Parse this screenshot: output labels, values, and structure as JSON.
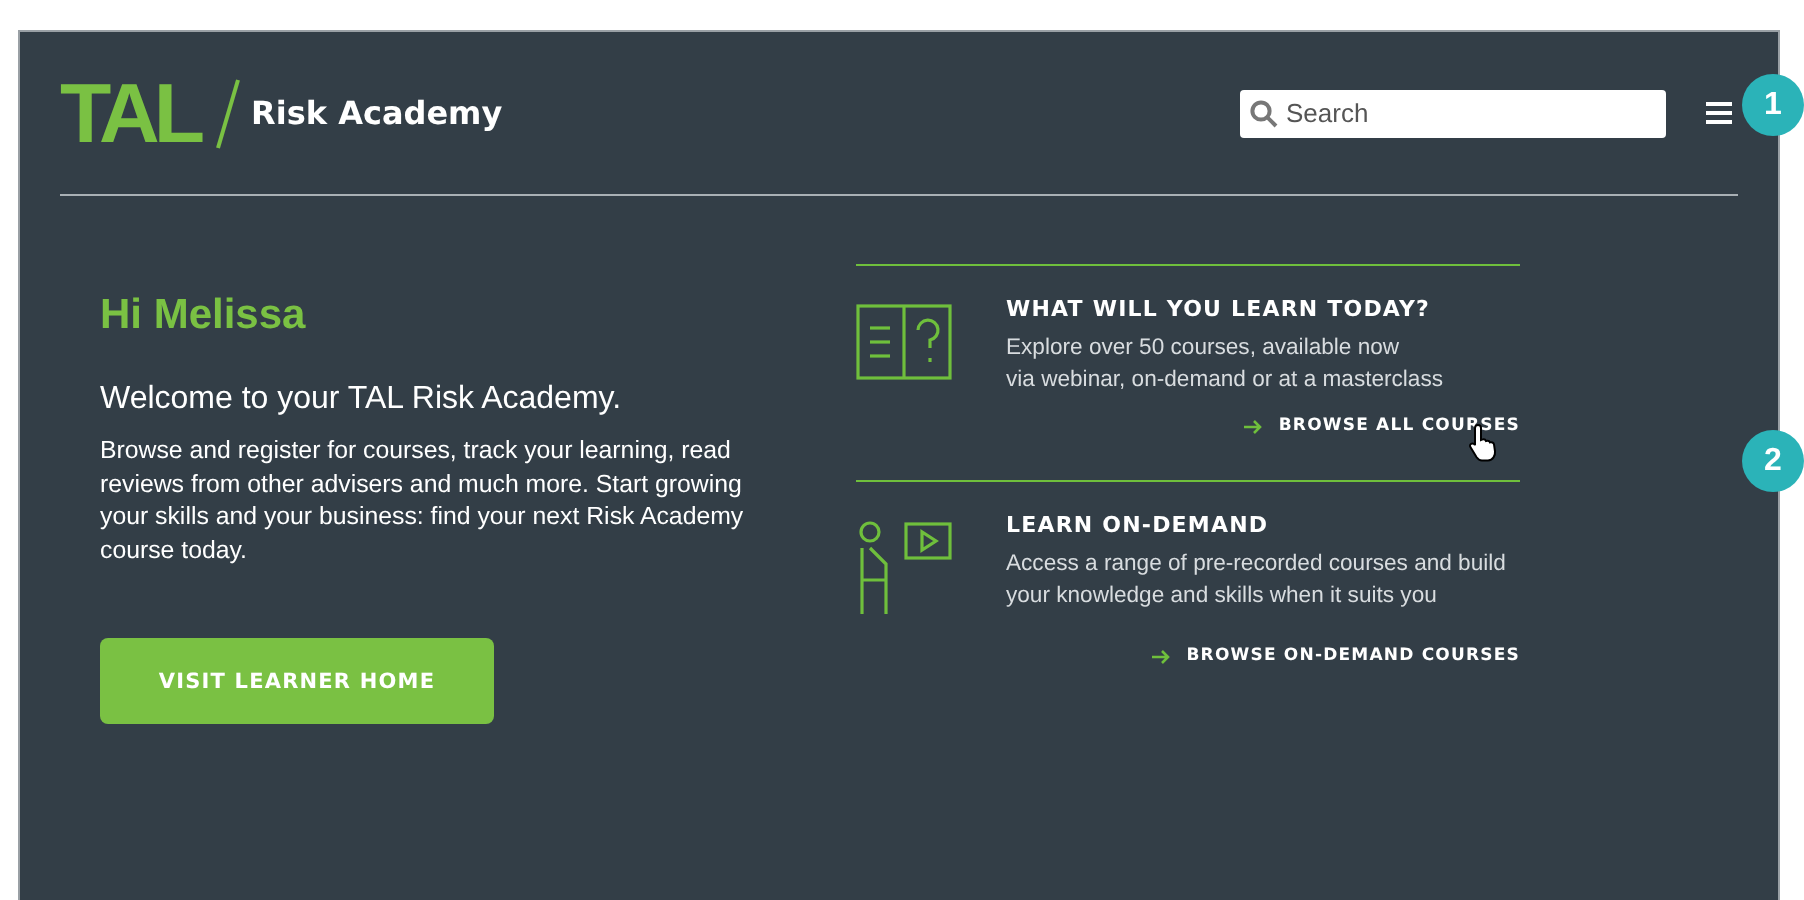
{
  "header": {
    "logo_mark": "TAL",
    "logo_name": "Risk Academy",
    "search": {
      "placeholder": "Search"
    }
  },
  "annotations": [
    {
      "label": "1"
    },
    {
      "label": "2"
    }
  ],
  "welcome": {
    "greeting": "Hi Melissa",
    "title": "Welcome to your TAL Risk Academy.",
    "body": "Browse and register for courses, track your learning, read reviews from other advisers and much more. Start growing your skills and your business: find your next Risk Academy course today.",
    "button": "VISIT LEARNER HOME"
  },
  "cards": [
    {
      "kind": "book",
      "heading": "WHAT WILL YOU LEARN TODAY?",
      "lines": [
        "Explore over 50 courses, available now",
        "via webinar, on-demand or at a masterclass"
      ],
      "link": "BROWSE ALL COURSES"
    },
    {
      "kind": "video",
      "heading": "LEARN ON-DEMAND",
      "lines": [
        "Access a range of pre-recorded courses and build",
        "your knowledge and skills when it suits you"
      ],
      "link": "BROWSE ON-DEMAND COURSES"
    }
  ]
}
